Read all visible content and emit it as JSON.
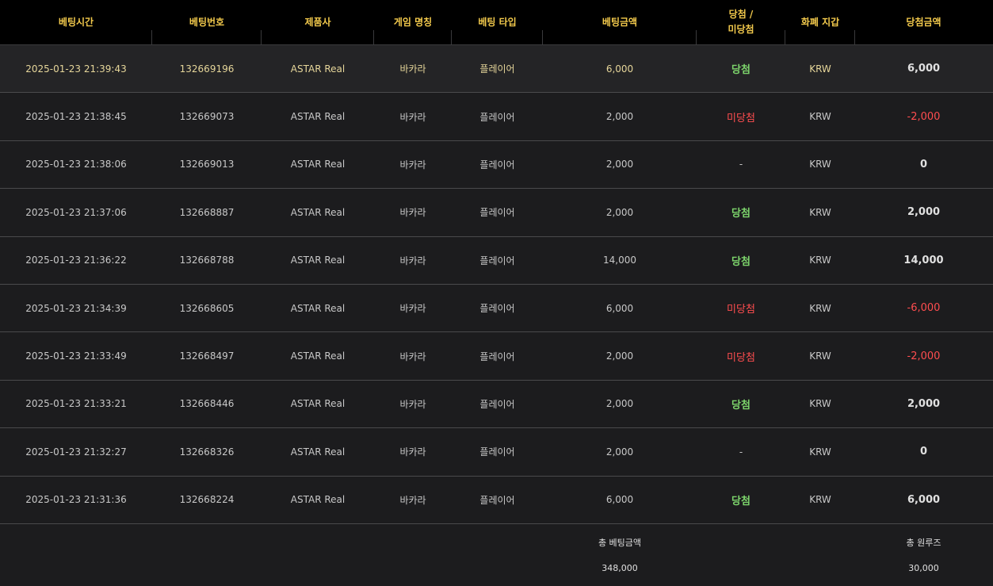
{
  "headers": [
    "베팅시간",
    "베팅번호",
    "제품사",
    "게임 명칭",
    "베팅 타입",
    "베팅금액",
    "당첨 /\n미당첨",
    "화폐 지갑",
    "당첨금액"
  ],
  "rows": [
    {
      "time": "2025-01-23 21:39:43",
      "id": "132669196",
      "vendor": "ASTAR Real",
      "game": "바카라",
      "type": "플레이어",
      "bet": "6,000",
      "result": "당첨",
      "currency": "KRW",
      "win": "6,000"
    },
    {
      "time": "2025-01-23 21:38:45",
      "id": "132669073",
      "vendor": "ASTAR Real",
      "game": "바카라",
      "type": "플레이어",
      "bet": "2,000",
      "result": "미당첨",
      "currency": "KRW",
      "win": "-2,000"
    },
    {
      "time": "2025-01-23 21:38:06",
      "id": "132669013",
      "vendor": "ASTAR Real",
      "game": "바카라",
      "type": "플레이어",
      "bet": "2,000",
      "result": "-",
      "currency": "KRW",
      "win": "0"
    },
    {
      "time": "2025-01-23 21:37:06",
      "id": "132668887",
      "vendor": "ASTAR Real",
      "game": "바카라",
      "type": "플레이어",
      "bet": "2,000",
      "result": "당첨",
      "currency": "KRW",
      "win": "2,000"
    },
    {
      "time": "2025-01-23 21:36:22",
      "id": "132668788",
      "vendor": "ASTAR Real",
      "game": "바카라",
      "type": "플레이어",
      "bet": "14,000",
      "result": "당첨",
      "currency": "KRW",
      "win": "14,000"
    },
    {
      "time": "2025-01-23 21:34:39",
      "id": "132668605",
      "vendor": "ASTAR Real",
      "game": "바카라",
      "type": "플레이어",
      "bet": "6,000",
      "result": "미당첨",
      "currency": "KRW",
      "win": "-6,000"
    },
    {
      "time": "2025-01-23 21:33:49",
      "id": "132668497",
      "vendor": "ASTAR Real",
      "game": "바카라",
      "type": "플레이어",
      "bet": "2,000",
      "result": "미당첨",
      "currency": "KRW",
      "win": "-2,000"
    },
    {
      "time": "2025-01-23 21:33:21",
      "id": "132668446",
      "vendor": "ASTAR Real",
      "game": "바카라",
      "type": "플레이어",
      "bet": "2,000",
      "result": "당첨",
      "currency": "KRW",
      "win": "2,000"
    },
    {
      "time": "2025-01-23 21:32:27",
      "id": "132668326",
      "vendor": "ASTAR Real",
      "game": "바카라",
      "type": "플레이어",
      "bet": "2,000",
      "result": "-",
      "currency": "KRW",
      "win": "0"
    },
    {
      "time": "2025-01-23 21:31:36",
      "id": "132668224",
      "vendor": "ASTAR Real",
      "game": "바카라",
      "type": "플레이어",
      "bet": "6,000",
      "result": "당첨",
      "currency": "KRW",
      "win": "6,000"
    }
  ],
  "footer": {
    "total_bet_label": "총 베팅금액",
    "total_bet_value": "348,000",
    "total_rolling_label": "총 원루즈",
    "total_rolling_value": "30,000"
  },
  "colors": {
    "header_text": "#f2c94c",
    "win": "#7cd36b",
    "lose": "#ff4d4f",
    "background": "#1c1c1e"
  }
}
